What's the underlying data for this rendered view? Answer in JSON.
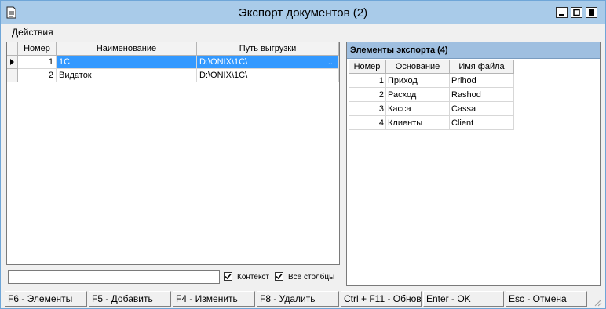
{
  "window": {
    "title": "Экспорт документов (2)",
    "icon": "document-icon"
  },
  "menu": {
    "actions": "Действия"
  },
  "documents_table": {
    "columns": [
      "Номер",
      "Наименование",
      "Путь выгрузки"
    ],
    "rows": [
      {
        "num": "1",
        "name": "1С",
        "path": "D:\\ONIX\\1C\\",
        "selected": true,
        "ellipsis": "..."
      },
      {
        "num": "2",
        "name": "Видаток",
        "path": "D:\\ONIX\\1C\\",
        "selected": false
      }
    ]
  },
  "search": {
    "value": "",
    "context_label": "Контекст",
    "context_checked": true,
    "all_columns_label": "Все столбцы",
    "all_columns_checked": true
  },
  "export_elements": {
    "title": "Элементы экспорта (4)",
    "columns": [
      "Номер",
      "Основание",
      "Имя файла"
    ],
    "rows": [
      {
        "num": "1",
        "basis": "Приход",
        "file": "Prihod"
      },
      {
        "num": "2",
        "basis": "Расход",
        "file": "Rashod"
      },
      {
        "num": "3",
        "basis": "Касса",
        "file": "Cassa"
      },
      {
        "num": "4",
        "basis": "Клиенты",
        "file": "Client"
      }
    ]
  },
  "footer": {
    "f6": "F6 - Элементы",
    "f5": "F5 - Добавить",
    "f4": "F4 - Изменить",
    "f8": "F8 - Удалить",
    "ctrl_f11": "Ctrl + F11 - Обнов",
    "enter": "Enter - OK",
    "esc": "Esc - Отмена"
  },
  "colors": {
    "titlebar": "#a9cbe9",
    "selection": "#3399ff",
    "panel_header": "#9fbfe0"
  }
}
